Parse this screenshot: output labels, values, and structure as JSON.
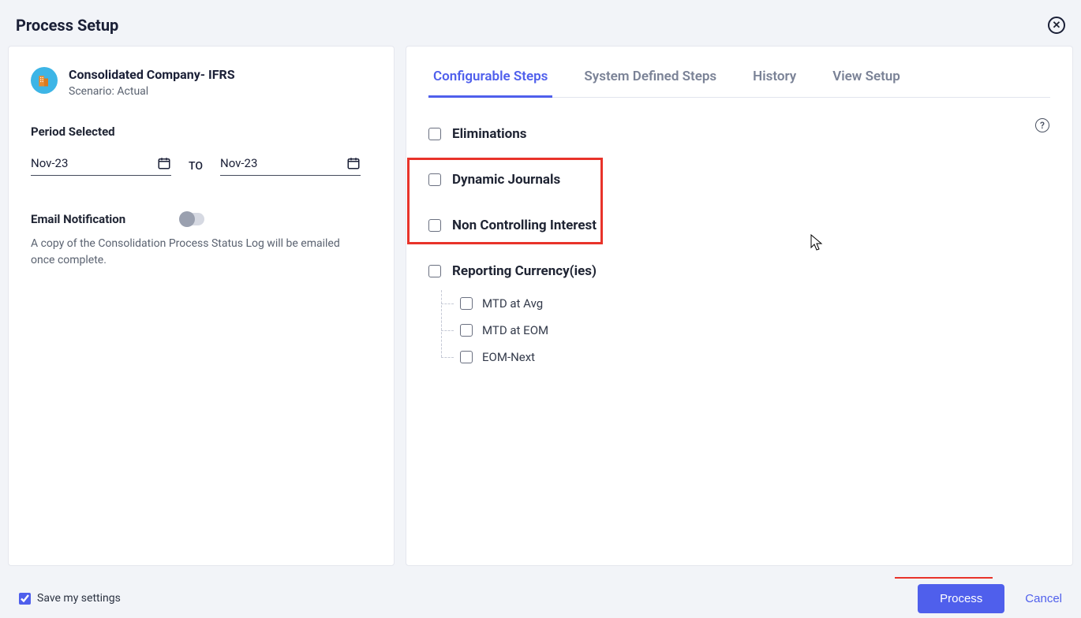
{
  "header": {
    "title": "Process Setup"
  },
  "company": {
    "name": "Consolidated Company- IFRS",
    "scenario_prefix": "Scenario: ",
    "scenario": "Actual"
  },
  "period": {
    "label": "Period Selected",
    "from": "Nov-23",
    "to_label": "TO",
    "to": "Nov-23"
  },
  "email": {
    "label": "Email Notification",
    "desc": "A copy of the Consolidation Process Status Log will be emailed once complete."
  },
  "tabs": {
    "configurable": "Configurable Steps",
    "system": "System Defined Steps",
    "history": "History",
    "view": "View Setup"
  },
  "steps": {
    "eliminations": "Eliminations",
    "dynamic_journals": "Dynamic Journals",
    "nci": "Non Controlling Interest",
    "reporting": "Reporting Currency(ies)",
    "sub": {
      "mtd_avg": "MTD at Avg",
      "mtd_eom": "MTD at EOM",
      "eom_next": "EOM-Next"
    }
  },
  "footer": {
    "save": "Save my settings",
    "process": "Process",
    "cancel": "Cancel"
  }
}
